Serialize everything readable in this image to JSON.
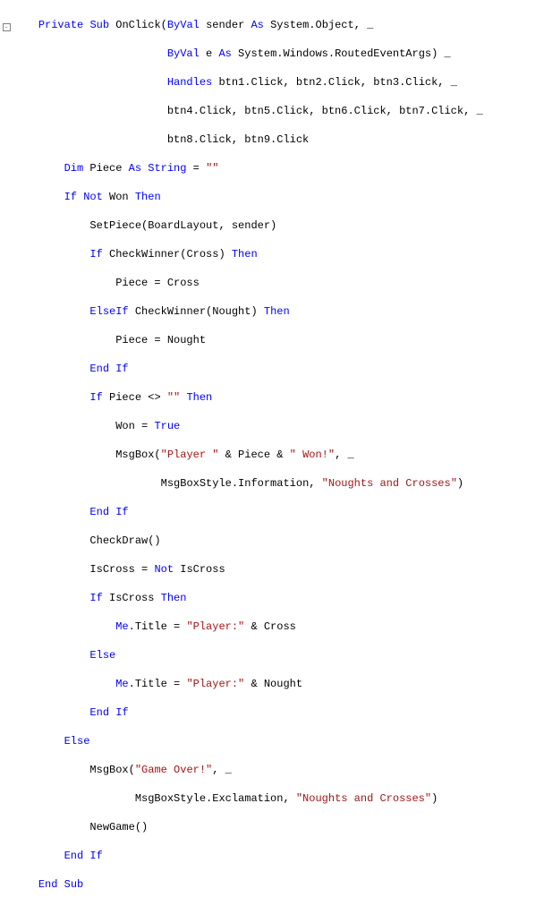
{
  "keywords": {
    "Private": "Private",
    "Sub": "Sub",
    "ByVal": "ByVal",
    "As": "As",
    "Handles": "Handles",
    "Dim": "Dim",
    "String": "String",
    "If": "If",
    "Not": "Not",
    "Then": "Then",
    "ElseIf": "ElseIf",
    "End": "End",
    "True": "True",
    "Else": "Else",
    "Me": "Me",
    "EndSub": "End",
    "Sub2": "Sub"
  },
  "idents": {
    "OnClick": " OnClick(",
    "sender": " sender ",
    "SystemObject": " System.Object, _",
    "e": " e ",
    "RoutedEventArgs": " System.Windows.RoutedEventArgs) _",
    "handles_l1": " btn1.Click, btn2.Click, btn3.Click, _",
    "handles_l2": "btn4.Click, btn5.Click, btn6.Click, btn7.Click, _",
    "handles_l3": "btn8.Click, btn9.Click",
    "Piece": " Piece ",
    "eq_empty": " = ",
    "Won": " Won ",
    "SetPiece": "SetPiece(BoardLayout, sender)",
    "CheckWinnerCross": " CheckWinner(Cross) ",
    "Piece_eq_Cross": "Piece = Cross",
    "CheckWinnerNought": " CheckWinner(Nought) ",
    "Piece_eq_Nought": "Piece = Nought",
    "EndIf": " If",
    "Piece_ne": " Piece <> ",
    "Won_eq": "Won = ",
    "MsgBox_open": "MsgBox(",
    "amp_Piece_amp": " & Piece & ",
    "comma_ul": ", _",
    "MsgBoxInfo": "MsgBoxStyle.Information, ",
    "close_paren": ")",
    "CheckDraw": "CheckDraw()",
    "IsCross_eq": "IsCross = ",
    "Not_sp": " ",
    "IsCross_id": "IsCross",
    "IsCross_sp": " IsCross ",
    "MeTitle_eq": ".Title = ",
    "amp_Cross": " & Cross",
    "amp_Nought": " & Nought",
    "MsgBoxExcl": "MsgBoxStyle.Exclamation, ",
    "NewGame": "NewGame()"
  },
  "strings": {
    "empty": "\"\"",
    "Player_sp": "\"Player \"",
    "Won_bang": "\" Won!\"",
    "NoughtsAndCrosses": "\"Noughts and Crosses\"",
    "Player_colon": "\"Player:\"",
    "GameOver": "\"Game Over!\""
  },
  "gutter": {
    "minus": "-"
  },
  "chart_data": {
    "type": "table",
    "note": "VB.NET code listing",
    "lines": [
      "Private Sub OnClick(ByVal sender As System.Object, _",
      "                    ByVal e As System.Windows.RoutedEventArgs) _",
      "                    Handles btn1.Click, btn2.Click, btn3.Click, _",
      "                    btn4.Click, btn5.Click, btn6.Click, btn7.Click, _",
      "                    btn8.Click, btn9.Click",
      "    Dim Piece As String = \"\"",
      "    If Not Won Then",
      "        SetPiece(BoardLayout, sender)",
      "        If CheckWinner(Cross) Then",
      "            Piece = Cross",
      "        ElseIf CheckWinner(Nought) Then",
      "            Piece = Nought",
      "        End If",
      "        If Piece <> \"\" Then",
      "            Won = True",
      "            MsgBox(\"Player \" & Piece & \" Won!\", _",
      "                   MsgBoxStyle.Information, \"Noughts and Crosses\")",
      "        End If",
      "        CheckDraw()",
      "        IsCross = Not IsCross",
      "        If IsCross Then",
      "            Me.Title = \"Player:\" & Cross",
      "        Else",
      "            Me.Title = \"Player:\" & Nought",
      "        End If",
      "    Else",
      "        MsgBox(\"Game Over!\", _",
      "               MsgBoxStyle.Exclamation, \"Noughts and Crosses\")",
      "        NewGame()",
      "    End If",
      "End Sub"
    ]
  }
}
